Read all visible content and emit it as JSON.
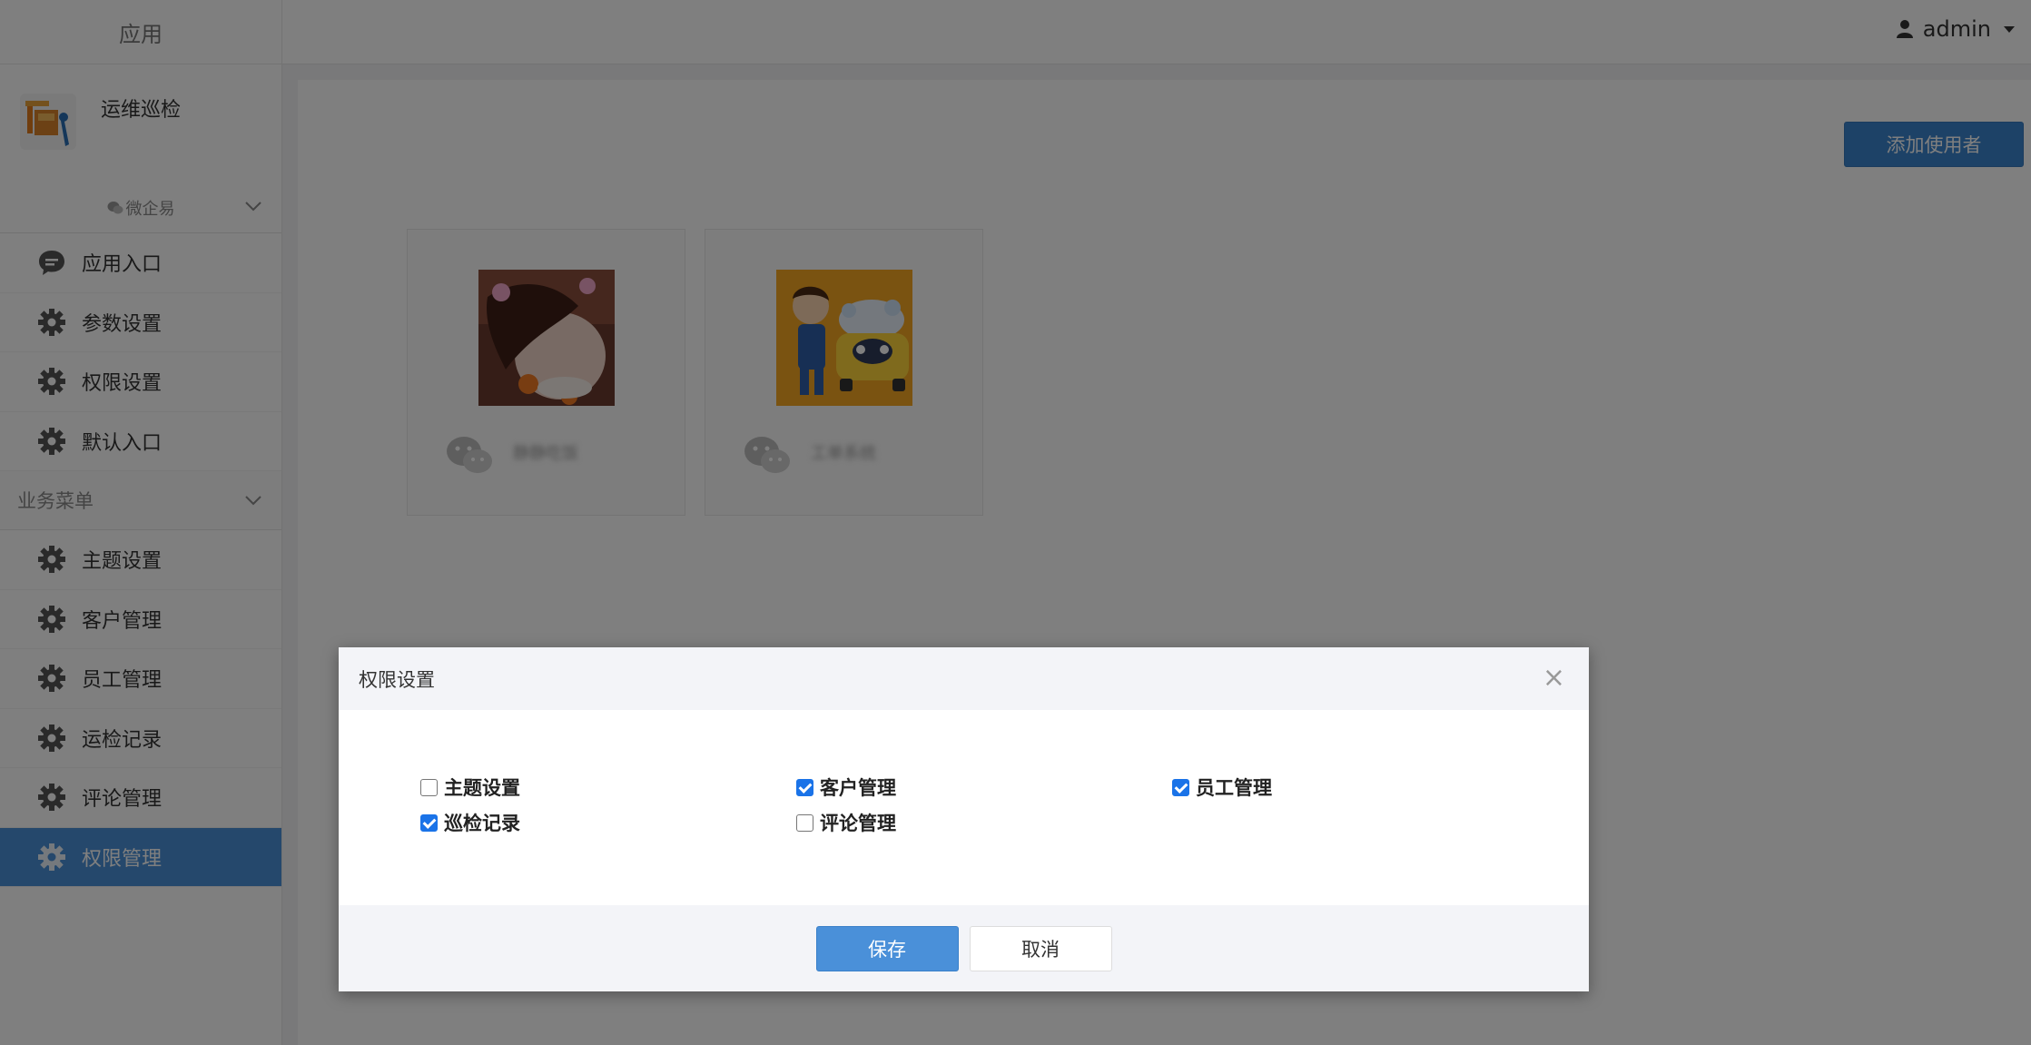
{
  "header": {
    "brand": "应用",
    "username": "admin"
  },
  "sidebar": {
    "app_name": "运维巡检",
    "group1": {
      "label": "微企易",
      "items": [
        {
          "label": "应用入口",
          "icon": "chat-bubble-icon"
        },
        {
          "label": "参数设置",
          "icon": "gear-icon"
        },
        {
          "label": "权限设置",
          "icon": "gear-icon"
        },
        {
          "label": "默认入口",
          "icon": "gear-icon"
        }
      ]
    },
    "group2": {
      "label": "业务菜单",
      "items": [
        {
          "label": "主题设置",
          "icon": "gear-icon"
        },
        {
          "label": "客户管理",
          "icon": "gear-icon"
        },
        {
          "label": "员工管理",
          "icon": "gear-icon"
        },
        {
          "label": "运检记录",
          "icon": "gear-icon"
        },
        {
          "label": "评论管理",
          "icon": "gear-icon"
        },
        {
          "label": "权限管理",
          "icon": "gear-icon",
          "active": true
        }
      ]
    }
  },
  "main": {
    "add_button": "添加使用者",
    "users": [
      {
        "name": "静静吃饭"
      },
      {
        "name": "工单系统"
      }
    ]
  },
  "modal": {
    "title": "权限设置",
    "permissions": [
      {
        "label": "主题设置",
        "checked": false
      },
      {
        "label": "客户管理",
        "checked": true
      },
      {
        "label": "员工管理",
        "checked": true
      },
      {
        "label": "巡检记录",
        "checked": true
      },
      {
        "label": "评论管理",
        "checked": false
      }
    ],
    "save_label": "保存",
    "cancel_label": "取消"
  },
  "colors": {
    "primary": "#4a90d9",
    "active_menu": "#4a90d9",
    "checkbox_on": "#1a73e8"
  }
}
